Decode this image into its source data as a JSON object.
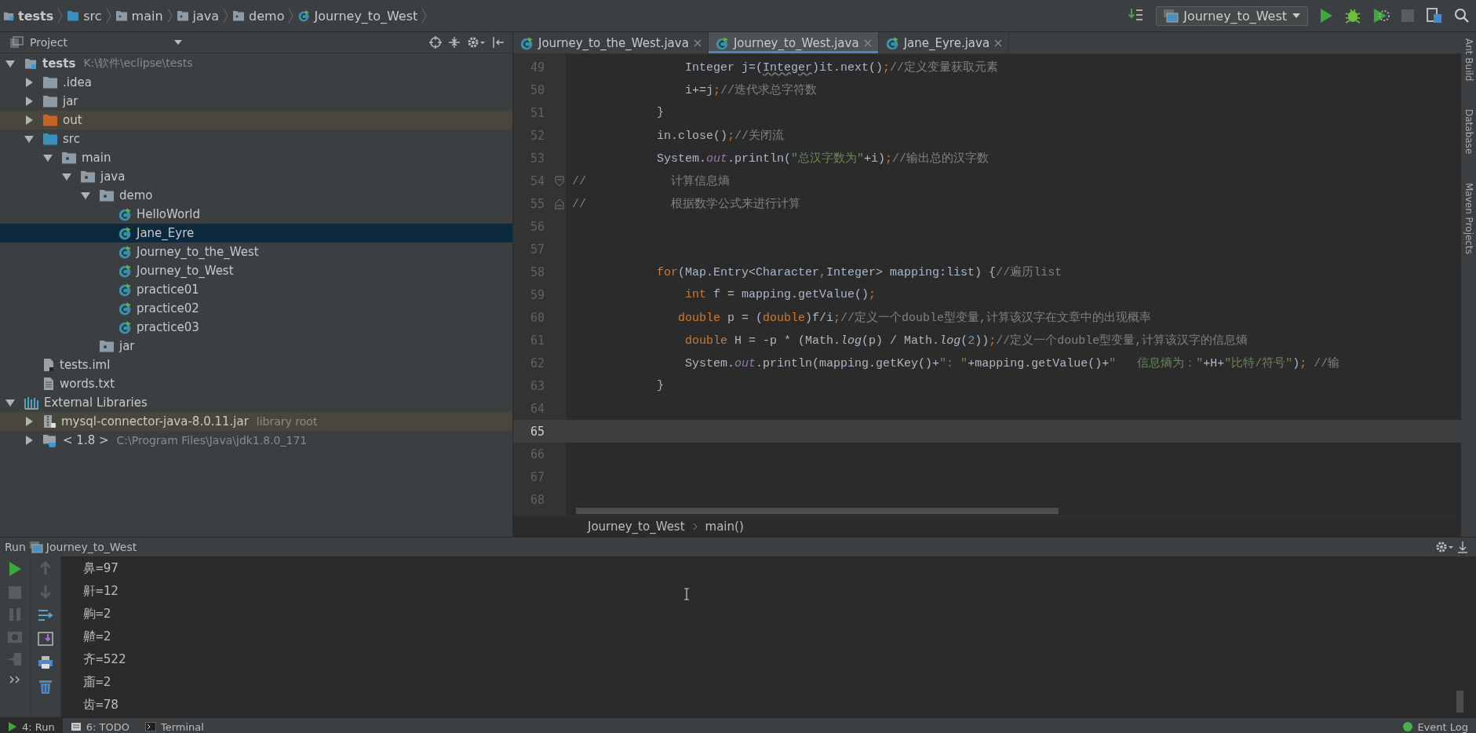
{
  "breadcrumbs": [
    {
      "label": "tests",
      "kind": "module"
    },
    {
      "label": "src",
      "kind": "source"
    },
    {
      "label": "main",
      "kind": "package"
    },
    {
      "label": "java",
      "kind": "package"
    },
    {
      "label": "demo",
      "kind": "package"
    },
    {
      "label": "Journey_to_West",
      "kind": "class"
    }
  ],
  "toolbar": {
    "run_config": "Journey_to_West"
  },
  "project_panel": {
    "title": "Project",
    "tree": [
      {
        "label": "tests",
        "kind": "module",
        "hint": "K:\\软件\\eclipse\\tests",
        "expanded": true,
        "selected": false,
        "highlighted": false,
        "children": [
          {
            "label": ".idea",
            "kind": "folder",
            "expanded": false,
            "selected": false,
            "highlighted": false
          },
          {
            "label": "jar",
            "kind": "folder",
            "expanded": false,
            "selected": false,
            "highlighted": false
          },
          {
            "label": "out",
            "kind": "excluded",
            "expanded": false,
            "selected": false,
            "highlighted": true
          },
          {
            "label": "src",
            "kind": "source",
            "expanded": true,
            "selected": false,
            "highlighted": false,
            "children": [
              {
                "label": "main",
                "kind": "package",
                "expanded": true,
                "selected": false,
                "highlighted": false,
                "children": [
                  {
                    "label": "java",
                    "kind": "package",
                    "expanded": true,
                    "selected": false,
                    "highlighted": false,
                    "children": [
                      {
                        "label": "demo",
                        "kind": "package",
                        "expanded": true,
                        "selected": false,
                        "highlighted": false,
                        "children": [
                          {
                            "label": "HelloWorld",
                            "kind": "class",
                            "selected": false,
                            "highlighted": false
                          },
                          {
                            "label": "Jane_Eyre",
                            "kind": "class",
                            "selected": true,
                            "highlighted": false
                          },
                          {
                            "label": "Journey_to_the_West",
                            "kind": "class",
                            "selected": false,
                            "highlighted": false
                          },
                          {
                            "label": "Journey_to_West",
                            "kind": "class",
                            "selected": false,
                            "highlighted": false
                          },
                          {
                            "label": "practice01",
                            "kind": "class",
                            "selected": false,
                            "highlighted": false
                          },
                          {
                            "label": "practice02",
                            "kind": "class",
                            "selected": false,
                            "highlighted": false
                          },
                          {
                            "label": "practice03",
                            "kind": "class",
                            "selected": false,
                            "highlighted": false
                          }
                        ]
                      },
                      {
                        "label": "jar",
                        "kind": "package",
                        "selected": false,
                        "highlighted": false
                      }
                    ]
                  }
                ]
              }
            ]
          },
          {
            "label": "tests.iml",
            "kind": "iml",
            "selected": false,
            "highlighted": false
          },
          {
            "label": "words.txt",
            "kind": "text",
            "selected": false,
            "highlighted": false
          }
        ]
      },
      {
        "label": "External Libraries",
        "kind": "libraries",
        "expanded": true,
        "selected": false,
        "highlighted": false,
        "children": [
          {
            "label": "mysql-connector-java-8.0.11.jar",
            "kind": "jar",
            "hint": "library root",
            "expanded": false,
            "selected": false,
            "highlighted": true
          },
          {
            "label": "< 1.8 >",
            "kind": "jdk",
            "hint": "C:\\Program Files\\Java\\jdk1.8.0_171",
            "expanded": false,
            "selected": false,
            "highlighted": false
          }
        ]
      }
    ]
  },
  "editor": {
    "tabs": [
      {
        "label": "Journey_to_the_West.java",
        "selected": false
      },
      {
        "label": "Journey_to_West.java",
        "selected": true
      },
      {
        "label": "Jane_Eyre.java",
        "selected": false
      }
    ],
    "lines": [
      {
        "number": "49",
        "current": false,
        "tokens": [
          {
            "text": "                Integer j=(",
            "kind": "plain"
          },
          {
            "text": "Integer",
            "kind": "warning"
          },
          {
            "text": ")it.next()",
            "kind": "plain"
          },
          {
            "text": ";",
            "kind": "keyword"
          },
          {
            "text": "//定义变量获取元素",
            "kind": "comment"
          }
        ]
      },
      {
        "number": "50",
        "current": false,
        "tokens": [
          {
            "text": "                i+=j",
            "kind": "plain"
          },
          {
            "text": ";",
            "kind": "keyword"
          },
          {
            "text": "//迭代求总字符数",
            "kind": "comment"
          }
        ]
      },
      {
        "number": "51",
        "current": false,
        "tokens": [
          {
            "text": "            }",
            "kind": "plain"
          }
        ]
      },
      {
        "number": "52",
        "current": false,
        "tokens": [
          {
            "text": "            in.close()",
            "kind": "plain"
          },
          {
            "text": ";",
            "kind": "keyword"
          },
          {
            "text": "//关闭流",
            "kind": "comment"
          }
        ]
      },
      {
        "number": "53",
        "current": false,
        "tokens": [
          {
            "text": "            System.",
            "kind": "plain"
          },
          {
            "text": "out",
            "kind": "field"
          },
          {
            "text": ".println(",
            "kind": "plain"
          },
          {
            "text": "\"总汉字数为\"",
            "kind": "string"
          },
          {
            "text": "+i)",
            "kind": "plain"
          },
          {
            "text": ";",
            "kind": "keyword"
          },
          {
            "text": "//输出总的汉字数",
            "kind": "comment"
          }
        ]
      },
      {
        "number": "54",
        "current": false,
        "kind": "fold-start",
        "tokens": [
          {
            "text": "//            计算信息熵",
            "kind": "comment"
          }
        ]
      },
      {
        "number": "55",
        "current": false,
        "kind": "fold-end",
        "tokens": [
          {
            "text": "//            根据数学公式来进行计算",
            "kind": "comment"
          }
        ]
      },
      {
        "number": "56",
        "current": false
      },
      {
        "number": "57",
        "current": false
      },
      {
        "number": "58",
        "current": false,
        "tokens": [
          {
            "text": "            for",
            "kind": "keyword"
          },
          {
            "text": "(Map.Entry<Character",
            "kind": "plain"
          },
          {
            "text": ",",
            "kind": "keyword"
          },
          {
            "text": "Integer> mapping:list) {",
            "kind": "plain"
          },
          {
            "text": "//遍历list",
            "kind": "comment"
          }
        ]
      },
      {
        "number": "59",
        "current": false,
        "tokens": [
          {
            "text": "                int",
            "kind": "keyword"
          },
          {
            "text": " f = mapping.getValue()",
            "kind": "plain"
          },
          {
            "text": ";",
            "kind": "keyword"
          }
        ]
      },
      {
        "number": "60",
        "current": false,
        "tokens": [
          {
            "text": "               double",
            "kind": "keyword"
          },
          {
            "text": " p = (",
            "kind": "plain"
          },
          {
            "text": "double",
            "kind": "keyword"
          },
          {
            "text": ")f/i",
            "kind": "plain"
          },
          {
            "text": ";",
            "kind": "keyword"
          },
          {
            "text": "//定义一个double型变量,计算该汉字在文章中的出现概率",
            "kind": "comment"
          }
        ]
      },
      {
        "number": "61",
        "current": false,
        "tokens": [
          {
            "text": "                double",
            "kind": "keyword"
          },
          {
            "text": " H = -p * (Math.",
            "kind": "plain"
          },
          {
            "text": "log",
            "kind": "static"
          },
          {
            "text": "(p) / Math.",
            "kind": "plain"
          },
          {
            "text": "log",
            "kind": "static"
          },
          {
            "text": "(",
            "kind": "plain"
          },
          {
            "text": "2",
            "kind": "number"
          },
          {
            "text": "))",
            "kind": "plain"
          },
          {
            "text": ";",
            "kind": "keyword"
          },
          {
            "text": "//定义一个double型变量,计算该汉字的信息熵",
            "kind": "comment"
          }
        ]
      },
      {
        "number": "62",
        "current": false,
        "tokens": [
          {
            "text": "                System.",
            "kind": "plain"
          },
          {
            "text": "out",
            "kind": "field"
          },
          {
            "text": ".println(mapping.getKey()+",
            "kind": "plain"
          },
          {
            "text": "\": \"",
            "kind": "string"
          },
          {
            "text": "+mapping.getValue()+",
            "kind": "plain"
          },
          {
            "text": "\"   信息熵为：\"",
            "kind": "string"
          },
          {
            "text": "+H+",
            "kind": "plain"
          },
          {
            "text": "\"比特/符号\"",
            "kind": "string"
          },
          {
            "text": ")",
            "kind": "plain"
          },
          {
            "text": ";",
            "kind": "keyword"
          },
          {
            "text": " //输",
            "kind": "comment"
          }
        ]
      },
      {
        "number": "63",
        "current": false,
        "tokens": [
          {
            "text": "            }",
            "kind": "plain"
          }
        ]
      },
      {
        "number": "64",
        "current": false
      },
      {
        "number": "65",
        "current": true
      },
      {
        "number": "66",
        "current": false
      },
      {
        "number": "67",
        "current": false
      },
      {
        "number": "68",
        "current": false
      }
    ],
    "breadcrumb": [
      "Journey_to_West",
      "main()"
    ]
  },
  "side_tools": [
    "Ant Build",
    "Database",
    "Maven Projects"
  ],
  "run_panel": {
    "title": "Run",
    "config": "Journey_to_West",
    "output": [
      "鼻=97",
      "鼾=12",
      "齁=2",
      "齄=2",
      "齐=522",
      "齑=2",
      "齿=78"
    ]
  },
  "bottom_tabs": [
    {
      "label": "4: Run",
      "kind": "run",
      "selected": true
    },
    {
      "label": "6: TODO",
      "kind": "todo",
      "selected": false
    },
    {
      "label": "Terminal",
      "kind": "terminal",
      "selected": false
    }
  ],
  "event_log": "Event Log"
}
